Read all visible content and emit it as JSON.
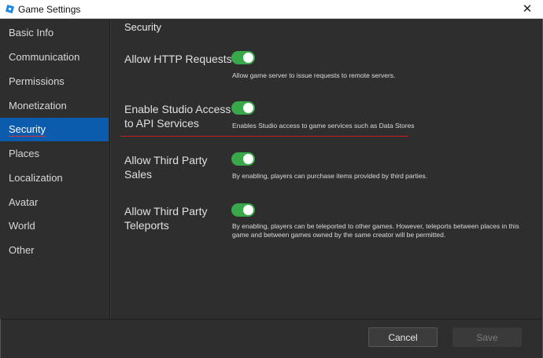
{
  "window": {
    "title": "Game Settings",
    "close_glyph": "✕",
    "app_icon": "roblox-studio-icon"
  },
  "sidebar": {
    "items": [
      {
        "label": "Basic Info"
      },
      {
        "label": "Communication"
      },
      {
        "label": "Permissions"
      },
      {
        "label": "Monetization"
      },
      {
        "label": "Security",
        "selected": true
      },
      {
        "label": "Places"
      },
      {
        "label": "Localization"
      },
      {
        "label": "Avatar"
      },
      {
        "label": "World"
      },
      {
        "label": "Other"
      }
    ]
  },
  "main": {
    "section_title": "Security",
    "settings": [
      {
        "label": "Allow HTTP Requests",
        "enabled": true,
        "description": "Allow game server to issue requests to remote servers."
      },
      {
        "label": "Enable Studio Access to API Services",
        "enabled": true,
        "description": "Enables Studio access to game services such as Data Stores"
      },
      {
        "label": "Allow Third Party Sales",
        "enabled": true,
        "description": "By enabling, players can purchase items provided by third parties."
      },
      {
        "label": "Allow Third Party Teleports",
        "enabled": true,
        "description": "By enabling, players can be teleported to other games. However, teleports between places in this game and between games owned by the same creator will be permitted."
      }
    ]
  },
  "footer": {
    "cancel_label": "Cancel",
    "save_label": "Save"
  },
  "colors": {
    "accent": "#0b5cad",
    "toggle_on": "#39a84a",
    "annotation": "#c21f1f"
  }
}
